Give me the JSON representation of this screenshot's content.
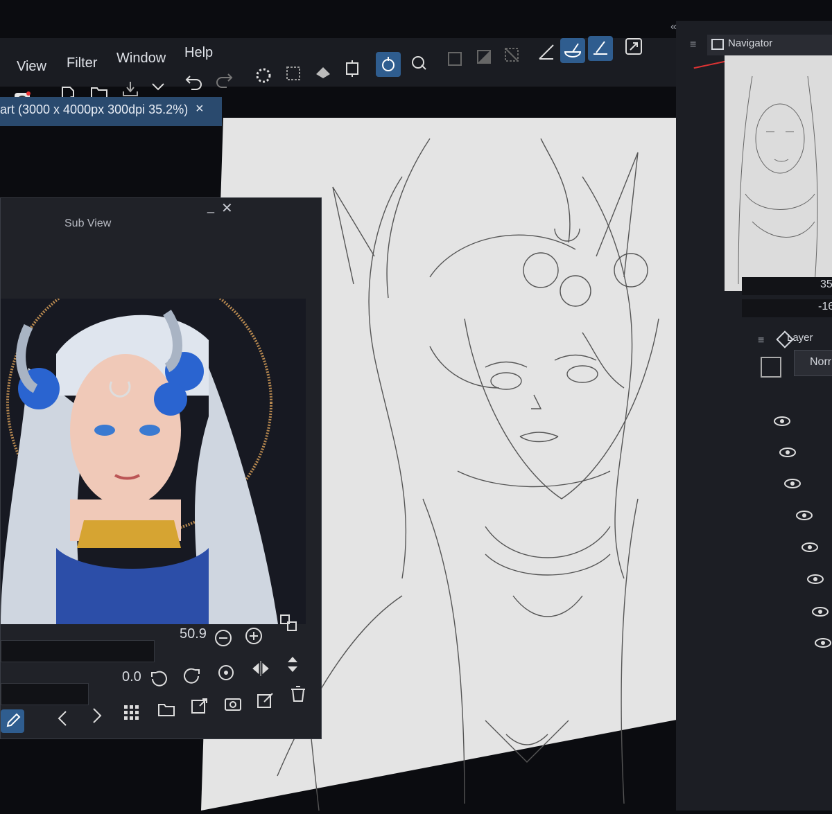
{
  "menu": {
    "view": "View",
    "filter": "Filter",
    "window": "Window",
    "help": "Help"
  },
  "document": {
    "tab_title": "art (3000 x 4000px 300dpi 35.2%)",
    "close": "×"
  },
  "subview": {
    "title": "Sub View",
    "minimize": "_",
    "close": "✕",
    "zoom_value": "50.9",
    "rotation_value": "0.0"
  },
  "navigator": {
    "title": "Navigator",
    "value_top": "35",
    "value_bottom": "-16"
  },
  "layer_panel": {
    "title": "Layer",
    "blend_mode": "Norr"
  },
  "colors": {
    "accent": "#2f5d8f",
    "panel": "#1c1e24",
    "canvas": "#e6e6e6"
  },
  "icons": [
    "new-file-icon",
    "open-folder-icon",
    "export-icon",
    "undo-icon",
    "redo-icon",
    "select-all-icon",
    "deselect-icon",
    "fill-icon",
    "crop-icon",
    "rotate-canvas-icon",
    "flip-icon",
    "zoom-out-icon",
    "zoom-in-icon",
    "eye-icon",
    "trash-icon",
    "camera-icon",
    "grid-icon",
    "eyedropper-icon"
  ]
}
